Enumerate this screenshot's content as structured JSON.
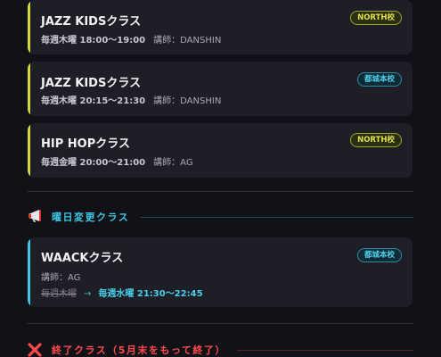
{
  "classes": [
    {
      "title": "JAZZ KIDSクラス",
      "schedule": "毎週木曜 18:00〜19:00",
      "teacher": "講師：DANSHIN",
      "badge": "NORTH校"
    },
    {
      "title": "JAZZ KIDSクラス",
      "schedule": "毎週木曜 20:15〜21:30",
      "teacher": "講師：DANSHIN",
      "badge": "都城本校"
    },
    {
      "title": "HIP HOPクラス",
      "schedule": "毎週金曜 20:00〜21:00",
      "teacher": "講師：AG",
      "badge": "NORTH校"
    }
  ],
  "day_change": {
    "icon": "megaphone-icon",
    "heading": "曜日変更クラス",
    "card": {
      "title": "WAACKクラス",
      "teacher": "講師：AG",
      "old_schedule": "毎週木曜",
      "arrow": "→",
      "new_schedule": "毎週水曜 21:30〜22:45",
      "badge": "都城本校"
    }
  },
  "ended": {
    "icon": "cross-mark-icon",
    "heading": "終了クラス（5月末をもって終了）"
  },
  "colors": {
    "north_accent": "#d4d93a",
    "tojo_accent": "#3fc6e4",
    "ended_accent": "#ff4b4b"
  }
}
